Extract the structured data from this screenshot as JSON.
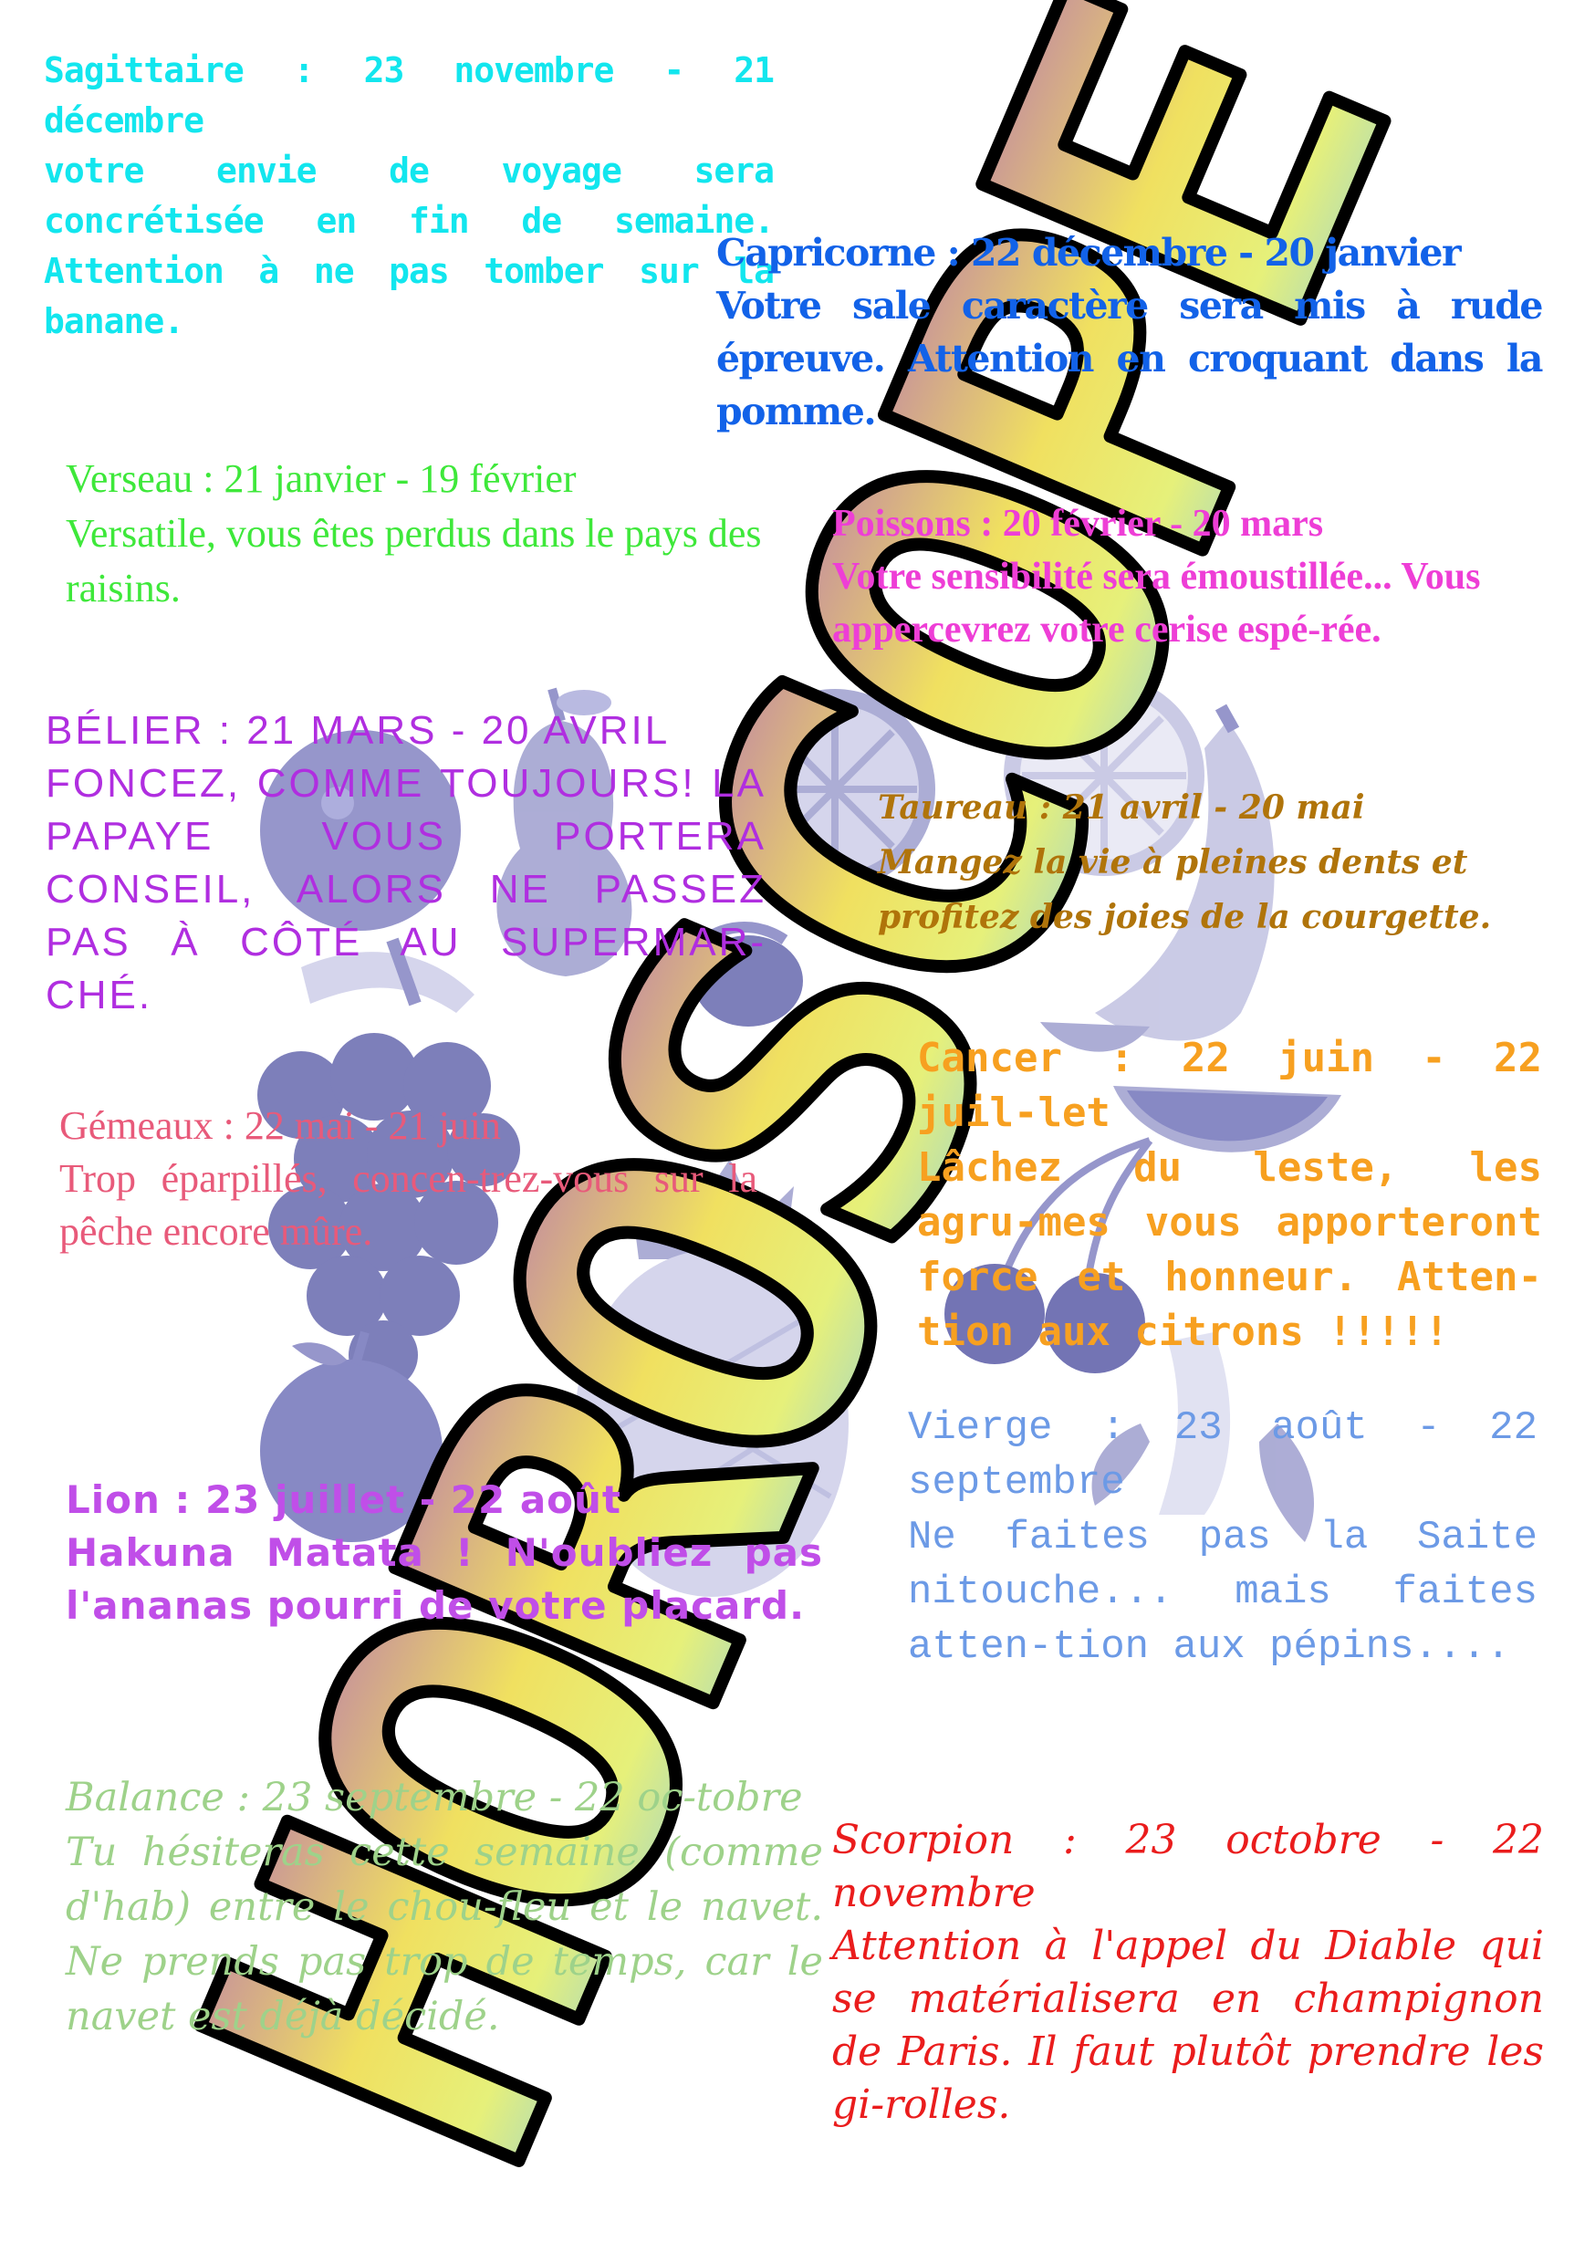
{
  "title": "HOROSCOPE",
  "colors": {
    "title_gradient": [
      "#b570b4",
      "#f0e060",
      "#e6f07a",
      "#7ec7f0"
    ],
    "title_outline": "#000000",
    "fruit": "#6e6fb8",
    "fruit_light": "#c5c6e6"
  },
  "decorations": {
    "fruits": [
      "apple-icon",
      "pear-icon",
      "orange-slice-icon",
      "banana-icon",
      "grapes-icon",
      "plum-icon",
      "pineapple-icon",
      "cherries-icon",
      "watermelon-icon",
      "peeled-banana-icon"
    ]
  },
  "signs": {
    "sagittaire": {
      "heading": "Sagittaire : 23 novembre - 21 décembre",
      "text": "votre envie de voyage sera concrétisée en fin de semaine. Attention à ne pas tomber sur la banane."
    },
    "capricorne": {
      "heading": "Capricorne : 22 décembre - 20 janvier",
      "text": "Votre sale caractère sera mis à rude épreuve. Attention en croquant dans la pomme."
    },
    "verseau": {
      "heading": "Verseau : 21 janvier - 19 février",
      "text": "Versatile, vous êtes perdus dans le pays des raisins."
    },
    "poissons": {
      "heading": "Poissons : 20 février - 20 mars",
      "text": "Votre sensibilité sera émoustillée... Vous appercevrez votre cerise espé-rée."
    },
    "belier": {
      "heading": "BÉLIER : 21 MARS - 20 AVRIL",
      "text": "FONCEZ, COMME TOUJOURS! LA PAPAYE VOUS PORTERA CONSEIL, ALORS NE PASSEZ PAS À CÔTÉ AU SUPERMAR-CHÉ."
    },
    "taureau": {
      "heading": "Taureau : 21 avril - 20 mai",
      "text": "Mangez la vie à pleines dents et profitez des joies de la courgette."
    },
    "gemeaux": {
      "heading": "Gémeaux : 22 mai - 21 juin",
      "text": "Trop éparpillés, concen-trez-vous sur la pêche encore mûre."
    },
    "cancer": {
      "heading": "Cancer : 22 juin - 22 juil-let",
      "text": "Lâchez du leste, les agru-mes vous apporteront force et honneur. Atten-tion aux citrons !!!!!"
    },
    "lion": {
      "heading": "Lion : 23 juillet - 22 août",
      "text": "Hakuna Matata ! N'oubliez pas l'ananas pourri de votre placard."
    },
    "vierge": {
      "heading": "Vierge : 23 août - 22 septembre",
      "text": "Ne faites pas la Saite nitouche... mais faites atten-tion aux pépins...."
    },
    "balance": {
      "heading": "Balance : 23 septembre - 22 oc-tobre",
      "text": "Tu hésiteras cette semaine (comme d'hab) entre le chou-fleu et le navet. Ne prends pas trop de temps, car le navet est déjà décidé."
    },
    "scorpion": {
      "heading": "Scorpion : 23 octobre - 22 novembre",
      "text": "Attention à l'appel du Diable qui se matérialisera en champignon de Paris. Il faut plutôt prendre les gi-rolles."
    }
  }
}
